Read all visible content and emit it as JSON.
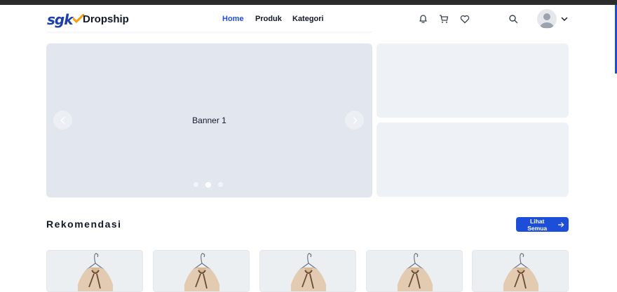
{
  "header": {
    "logo_text": "sgk",
    "brand_name": "Dropship",
    "menu": [
      {
        "label": "Home",
        "active": true
      },
      {
        "label": "Produk",
        "active": false
      },
      {
        "label": "Kategori",
        "active": false
      }
    ],
    "icons": [
      "bell-icon",
      "cart-icon",
      "heart-icon",
      "search-icon",
      "avatar",
      "chevron-down-icon"
    ]
  },
  "banner": {
    "main_text": "Banner 1",
    "dots": [
      false,
      true,
      false
    ]
  },
  "recommend": {
    "title": "Rekomendasi",
    "see_all_label": "Lihat Semua",
    "products": [
      "product-1",
      "product-2",
      "product-3",
      "product-4",
      "product-5"
    ]
  },
  "colors": {
    "accent": "#1d4ed8",
    "banner_bg": "#e2e7ef",
    "side_bg": "#eef1f6"
  }
}
